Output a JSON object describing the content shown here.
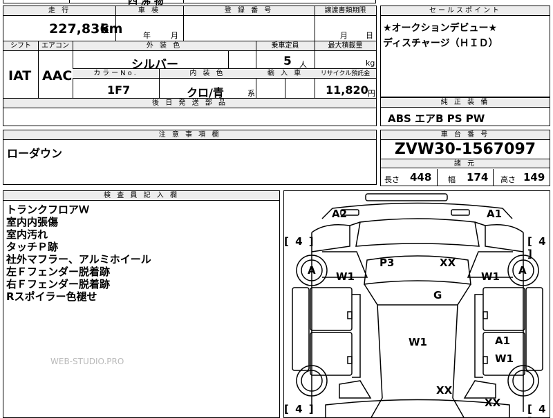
{
  "top_fragment": "四 沸 物",
  "headers": {
    "mileage": "走 行",
    "inspection": "車 検",
    "registration": "登 録 番 号",
    "transfer_deadline": "譲渡書類期限",
    "sales_point": "セールスポイント",
    "shift": "シフト",
    "aircon": "エアコン",
    "exterior_color": "外 装 色",
    "capacity": "乗車定員",
    "max_load": "最大積載量",
    "color_no": "カラーNo.",
    "interior_color": "内 装 色",
    "import": "輸 入 車",
    "recycle_fee": "リサイクル預託金",
    "later_parts": "後 日 発 送 部 品",
    "standard_equipment": "純 正 装 備",
    "caution": "注 意 事 項 欄",
    "chassis_no": "車 台 番 号",
    "dimensions": "諸 元",
    "inspector_notes": "検 査 員 記 入 欄"
  },
  "vehicle": {
    "mileage": "227,836",
    "mileage_unit": "km",
    "inspection_year_unit": "年",
    "inspection_month_unit": "月",
    "transfer_month_unit": "月",
    "transfer_day_unit": "日",
    "shift": "IAT",
    "aircon": "AAC",
    "exterior_color": "シルバー",
    "capacity": "5",
    "capacity_unit": "人",
    "load_unit": "kg",
    "color_no": "1F7",
    "interior_color": "クロ/青",
    "interior_suffix": "系",
    "recycle_fee": "11,820",
    "recycle_unit": "円",
    "chassis_no": "ZVW30-1567097",
    "equipment": "ABS エアB PS PW",
    "caution_text": "ローダウン"
  },
  "sales_points": [
    "★オークションデビュー★",
    "ディスチャージ（ＨＩＤ）"
  ],
  "dimensions": {
    "length_label": "長さ",
    "length": "448",
    "width_label": "幅",
    "width": "174",
    "height_label": "高さ",
    "height": "149"
  },
  "inspector_notes": [
    "トランクフロアＷ",
    "室内内張傷",
    "室内汚れ",
    "タッチＰ跡",
    "社外マフラー、アルミホイール",
    "左Ｆフェンダー脱着跡",
    "右Ｆフェンダー脱着跡",
    "Rスポイラー色褪せ"
  ],
  "watermark": "WEB-STUDIO.PRO",
  "diagram": {
    "tire_counts": [
      "[ 4 ]",
      "[ 4 ]",
      "[ 4 ]",
      "[ 4 ]"
    ],
    "marks": {
      "a2_top_left": "A2",
      "a1_top_right": "A1",
      "a_left_front_wheel": "A",
      "a_right_front_wheel": "A",
      "w1_left_fender": "W1",
      "w1_right_fender": "W1",
      "p3_roof": "P3",
      "xx_roof": "XX",
      "g_windshield": "G",
      "w1_center": "W1",
      "a1_right_door": "A1",
      "w1_right_door": "W1",
      "xx_rear_center": "XX",
      "xx_rear_right": "XX"
    }
  }
}
